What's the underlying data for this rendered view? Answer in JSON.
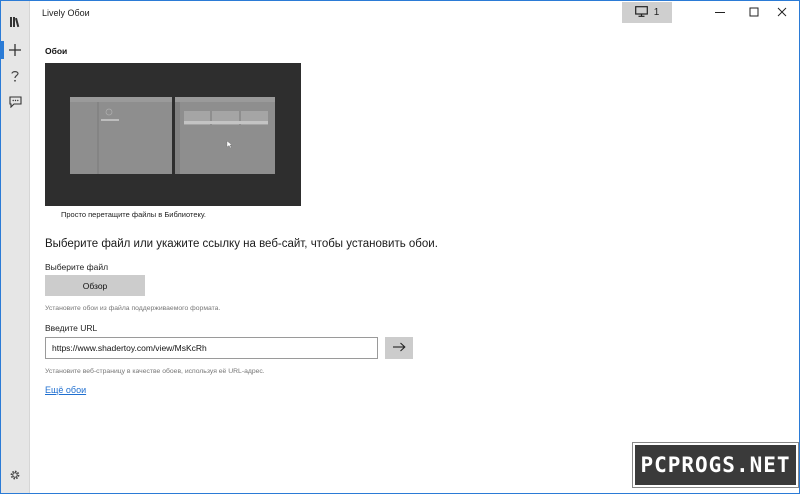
{
  "app": {
    "title": "Lively Обои"
  },
  "titlebar": {
    "monitor_count": "1"
  },
  "nav": {
    "items": [
      {
        "name": "library"
      },
      {
        "name": "add"
      },
      {
        "name": "help"
      },
      {
        "name": "feedback"
      },
      {
        "name": "settings"
      }
    ],
    "active": "add"
  },
  "main": {
    "section_title": "Обои",
    "preview_caption": "Просто перетащите файлы в Библиотеку.",
    "heading": "Выберите файл или укажите ссылку на веб-сайт, чтобы установить обои.",
    "file": {
      "label": "Выберите файл",
      "button_label": "Обзор",
      "hint": "Установите обои из файла поддерживаемого формата."
    },
    "url": {
      "label": "Введите URL",
      "value": "https://www.shadertoy.com/view/MsKcRh",
      "hint": "Установите веб-страницу в качестве обоев, используя её URL-адрес."
    },
    "more_link": "Ещё обои"
  },
  "watermark": "PCPROGS.NET",
  "colors": {
    "accent": "#2b7bd6",
    "button": "#cccccc",
    "link": "#1f6fd0"
  }
}
